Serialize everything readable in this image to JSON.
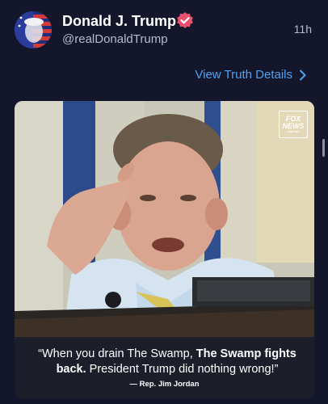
{
  "post": {
    "display_name": "Donald J. Trump",
    "handle": "@realDonaldTrump",
    "timestamp": "11h",
    "verified_icon": "verified-badge-icon",
    "details_link": "View Truth Details",
    "details_icon": "chevron-right-icon"
  },
  "media": {
    "logo_line1": "FOX",
    "logo_line2": "NEWS",
    "logo_line3": "channel",
    "quote_part1": "“When you drain The Swamp, ",
    "quote_bold": "The Swamp fights back.",
    "quote_part2": " President Trump did nothing wrong!”",
    "attribution": "— Rep. Jim Jordan"
  },
  "colors": {
    "background": "#14172b",
    "link": "#4fa3f2",
    "verified": "#e8506b",
    "secondary_text": "#b7bbcc"
  }
}
